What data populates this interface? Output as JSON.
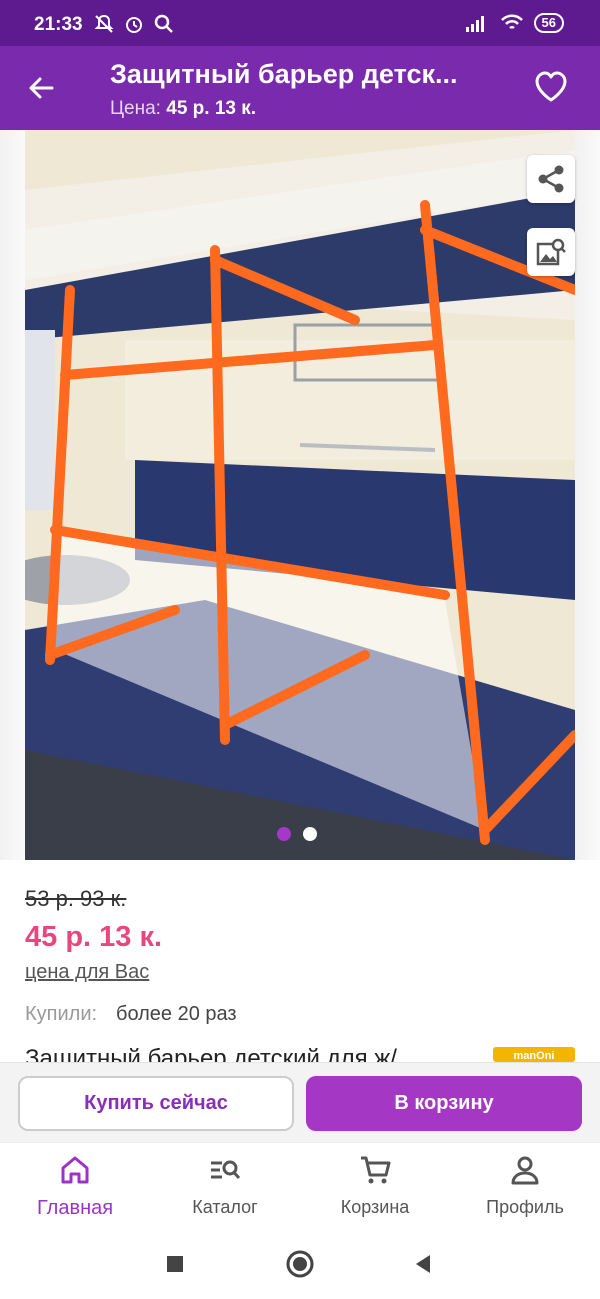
{
  "status_bar": {
    "time": "21:33",
    "battery": "56",
    "icons": [
      "notifications-off-icon",
      "alarm-icon",
      "search-icon",
      "signal-icon",
      "wifi-icon",
      "battery-icon"
    ]
  },
  "app_bar": {
    "title": "Защитный барьер детск...",
    "price_label": "Цена:",
    "price_value": "45 р. 13 к.",
    "background": "#7a2aad"
  },
  "gallery": {
    "image_count": 2,
    "active_index": 0
  },
  "product": {
    "old_price": "53 р. 93 к.",
    "price": "45 р. 13 к.",
    "price_note": "цена для Вас",
    "bought_label": "Купили:",
    "bought_value": "более 20 раз",
    "name": "Защитный барьер детский для ж/",
    "brand": "manOni"
  },
  "actions": {
    "buy_now": "Купить сейчас",
    "add_to_cart": "В корзину",
    "accent": "#a437c4"
  },
  "bottom_nav": {
    "items": [
      {
        "label": "Главная",
        "icon": "home-icon",
        "active": true
      },
      {
        "label": "Каталог",
        "icon": "catalog-search-icon",
        "active": false
      },
      {
        "label": "Корзина",
        "icon": "cart-icon",
        "active": false
      },
      {
        "label": "Профиль",
        "icon": "profile-icon",
        "active": false
      }
    ]
  },
  "colors": {
    "price": "#e8477e",
    "active_nav": "#9c33c3",
    "status_bar": "#5e1a8f"
  }
}
